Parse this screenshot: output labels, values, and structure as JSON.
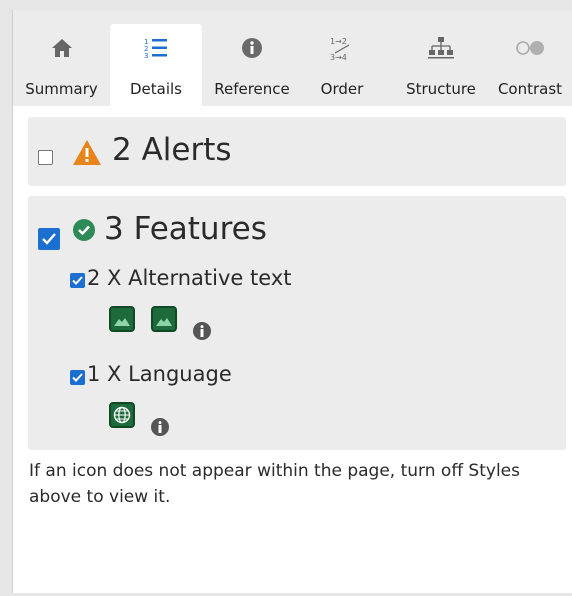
{
  "tabs": [
    {
      "label": "Summary",
      "icon": "home-icon",
      "active": false
    },
    {
      "label": "Details",
      "icon": "list-icon",
      "active": true
    },
    {
      "label": "Reference",
      "icon": "info-icon",
      "active": false
    },
    {
      "label": "Order",
      "icon": "order-icon",
      "active": false
    },
    {
      "label": "Structure",
      "icon": "structure-icon",
      "active": false
    },
    {
      "label": "Contrast",
      "icon": "contrast-icon",
      "active": false
    }
  ],
  "alerts": {
    "title": "2 Alerts",
    "checked": false
  },
  "features": {
    "title": "3 Features",
    "checked": true,
    "items": [
      {
        "label": "2 X Alternative text",
        "checked": true,
        "icons": [
          "image-icon",
          "image-icon"
        ]
      },
      {
        "label": "1 X Language",
        "checked": true,
        "icons": [
          "globe-icon"
        ]
      }
    ]
  },
  "note": "If an icon does not appear within the page, turn off Styles above to view it.",
  "colors": {
    "accent": "#1a6fd0",
    "alert": "#e8841a",
    "success": "#2e8b57",
    "feature": "#1d6b3a"
  }
}
